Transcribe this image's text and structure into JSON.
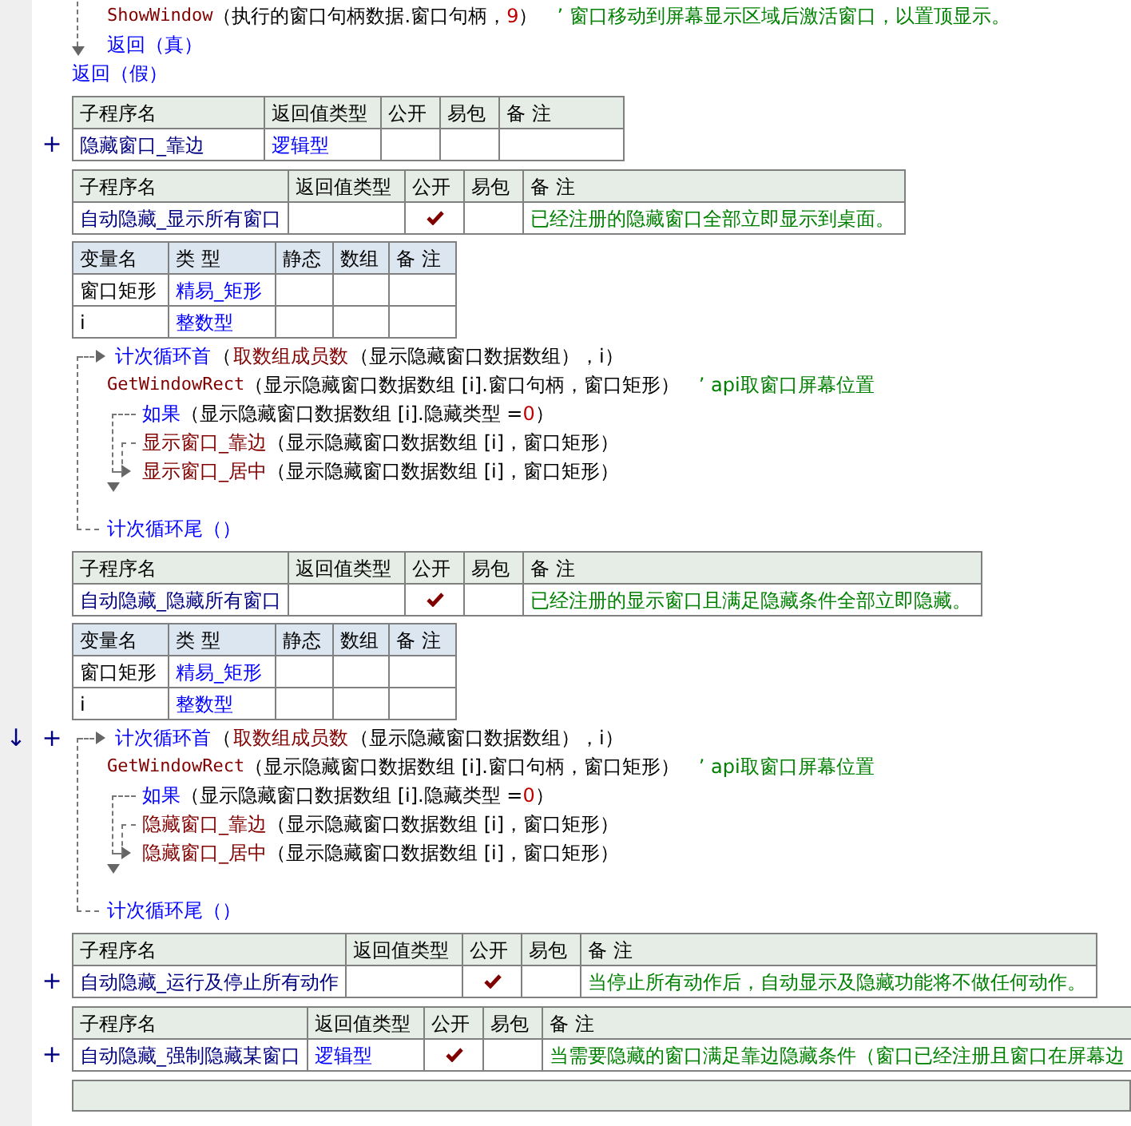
{
  "blocks": [
    {
      "kind": "code",
      "lines": [
        {
          "kind": "branch",
          "children": [
            {
              "kind": "stmt",
              "parts": [
                {
                  "kind": "api",
                  "text": "ShowWindow"
                },
                {
                  "kind": "arg",
                  "text": "（执行的窗口句柄数据.窗口句柄，"
                },
                {
                  "kind": "num",
                  "text": "9"
                },
                {
                  "kind": "arg",
                  "text": "）"
                },
                {
                  "kind": "comment",
                  "text": "’ 窗口移动到屏幕显示区域后激活窗口，以置顶显示。"
                }
              ]
            },
            {
              "kind": "stmt",
              "parts": [
                {
                  "kind": "kw",
                  "text": "返回（真）"
                }
              ]
            }
          ]
        },
        {
          "kind": "stmt",
          "parts": [
            {
              "kind": "kw",
              "text": "返回（假）"
            }
          ]
        }
      ]
    },
    {
      "kind": "sub_table",
      "header": [
        "子程序名",
        "返回值类型",
        "公开",
        "易包",
        "备 注"
      ],
      "rows": [
        {
          "marker": "+",
          "name": "隐藏窗口_靠边",
          "type": "逻辑型",
          "public": false
        }
      ]
    },
    {
      "kind": "sub_table",
      "header": [
        "子程序名",
        "返回值类型",
        "公开",
        "易包",
        "备 注"
      ],
      "rows": [
        {
          "name": "自动隐藏_显示所有窗口",
          "public": true,
          "remark": "已经注册的隐藏窗口全部立即显示到桌面。"
        }
      ]
    },
    {
      "kind": "var_table",
      "header": [
        "变量名",
        "类 型",
        "静态",
        "数组",
        "备 注"
      ],
      "rows": [
        {
          "name": "窗口矩形",
          "type": "精易_矩形"
        },
        {
          "name": "i",
          "type": "整数型"
        }
      ]
    },
    {
      "kind": "code",
      "lines": [
        {
          "kind": "loop",
          "parts": [
            {
              "kind": "kw",
              "text": "计次循环首"
            },
            {
              "kind": "arg",
              "text": "（"
            },
            {
              "kind": "fn",
              "text": "取数组成员数"
            },
            {
              "kind": "arg",
              "text": "（显示隐藏窗口数据数组），i）"
            }
          ],
          "children": [
            {
              "kind": "stmt",
              "parts": [
                {
                  "kind": "api",
                  "text": "GetWindowRect"
                },
                {
                  "kind": "arg",
                  "text": "（显示隐藏窗口数据数组 [i].窗口句柄，窗口矩形）"
                },
                {
                  "kind": "comment",
                  "text": "’ api取窗口屏幕位置"
                }
              ]
            },
            {
              "kind": "if",
              "parts": [
                {
                  "kind": "kw",
                  "text": "如果"
                },
                {
                  "kind": "arg",
                  "text": "（显示隐藏窗口数据数组 [i].隐藏类型 = "
                },
                {
                  "kind": "num",
                  "text": "0"
                },
                {
                  "kind": "arg",
                  "text": "）"
                }
              ],
              "children": [
                {
                  "kind": "stmt",
                  "parts": [
                    {
                      "kind": "fn",
                      "text": "显示窗口_靠边"
                    },
                    {
                      "kind": "arg",
                      "text": "（显示隐藏窗口数据数组 [i]，窗口矩形）"
                    }
                  ]
                }
              ],
              "else": [
                {
                  "kind": "stmt",
                  "parts": [
                    {
                      "kind": "fn",
                      "text": "显示窗口_居中"
                    },
                    {
                      "kind": "arg",
                      "text": "（显示隐藏窗口数据数组 [i]，窗口矩形）"
                    }
                  ]
                }
              ]
            }
          ],
          "end": [
            {
              "kind": "kw",
              "text": "计次循环尾（）"
            }
          ]
        }
      ]
    },
    {
      "kind": "sub_table",
      "header": [
        "子程序名",
        "返回值类型",
        "公开",
        "易包",
        "备 注"
      ],
      "rows": [
        {
          "name": "自动隐藏_隐藏所有窗口",
          "public": true,
          "remark": "已经注册的显示窗口且满足隐藏条件全部立即隐藏。"
        }
      ]
    },
    {
      "kind": "var_table",
      "header": [
        "变量名",
        "类 型",
        "静态",
        "数组",
        "备 注"
      ],
      "rows": [
        {
          "name": "窗口矩形",
          "type": "精易_矩形"
        },
        {
          "name": "i",
          "type": "整数型"
        }
      ]
    },
    {
      "kind": "code",
      "lines": [
        {
          "kind": "loop",
          "markers": [
            "↓",
            "+"
          ],
          "parts": [
            {
              "kind": "kw",
              "text": "计次循环首"
            },
            {
              "kind": "arg",
              "text": "（"
            },
            {
              "kind": "fn",
              "text": "取数组成员数"
            },
            {
              "kind": "arg",
              "text": "（显示隐藏窗口数据数组），i）"
            }
          ],
          "children": [
            {
              "kind": "stmt",
              "parts": [
                {
                  "kind": "api",
                  "text": "GetWindowRect"
                },
                {
                  "kind": "arg",
                  "text": "（显示隐藏窗口数据数组 [i].窗口句柄，窗口矩形）"
                },
                {
                  "kind": "comment",
                  "text": "’ api取窗口屏幕位置"
                }
              ]
            },
            {
              "kind": "if",
              "parts": [
                {
                  "kind": "kw",
                  "text": "如果"
                },
                {
                  "kind": "arg",
                  "text": "（显示隐藏窗口数据数组 [i].隐藏类型 = "
                },
                {
                  "kind": "num",
                  "text": "0"
                },
                {
                  "kind": "arg",
                  "text": "）"
                }
              ],
              "children": [
                {
                  "kind": "stmt",
                  "parts": [
                    {
                      "kind": "fn",
                      "text": "隐藏窗口_靠边"
                    },
                    {
                      "kind": "arg",
                      "text": "（显示隐藏窗口数据数组 [i]，窗口矩形）"
                    }
                  ]
                }
              ],
              "else": [
                {
                  "kind": "stmt",
                  "parts": [
                    {
                      "kind": "fn",
                      "text": "隐藏窗口_居中"
                    },
                    {
                      "kind": "arg",
                      "text": "（显示隐藏窗口数据数组 [i]，窗口矩形）"
                    }
                  ]
                }
              ]
            }
          ],
          "end": [
            {
              "kind": "kw",
              "text": "计次循环尾（）"
            }
          ]
        }
      ]
    },
    {
      "kind": "sub_table",
      "header": [
        "子程序名",
        "返回值类型",
        "公开",
        "易包",
        "备 注"
      ],
      "rows": [
        {
          "marker": "+",
          "name": "自动隐藏_运行及停止所有动作",
          "public": true,
          "remark": "当停止所有动作后，自动显示及隐藏功能将不做任何动作。"
        }
      ]
    },
    {
      "kind": "sub_table",
      "header": [
        "子程序名",
        "返回值类型",
        "公开",
        "易包",
        "备 注"
      ],
      "rows": [
        {
          "marker": "+",
          "name": "自动隐藏_强制隐藏某窗口",
          "type": "逻辑型",
          "public": true,
          "remark": "当需要隐藏的窗口满足靠边隐藏条件（窗口已经注册且窗口在屏幕边"
        }
      ]
    },
    {
      "kind": "table_edge"
    }
  ]
}
